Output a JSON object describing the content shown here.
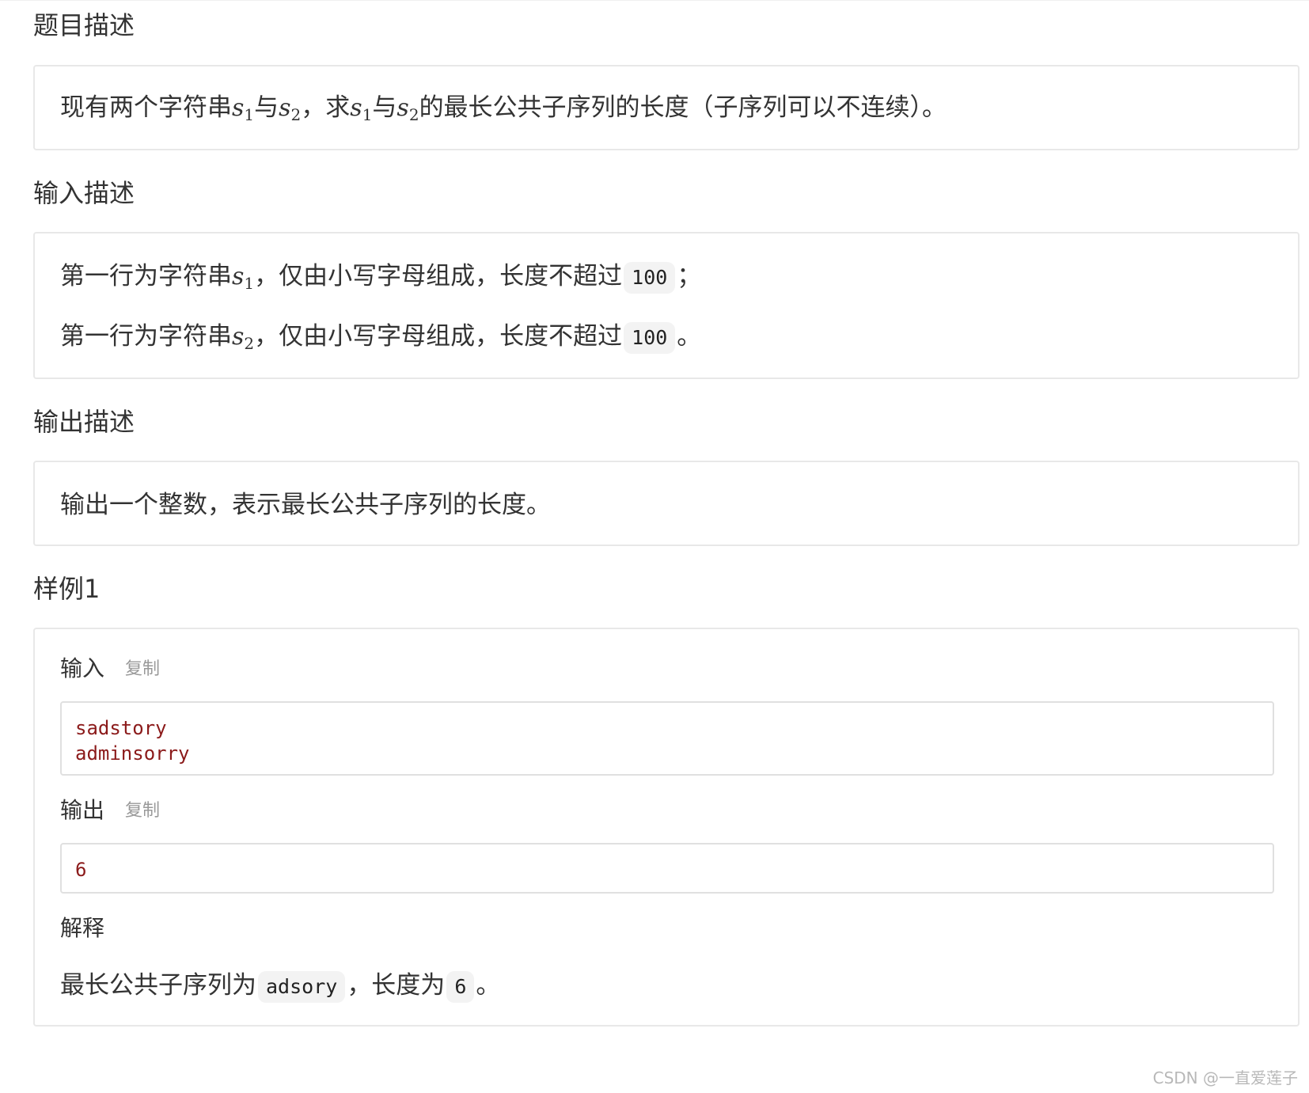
{
  "sections": {
    "description": {
      "title": "题目描述",
      "text_a": "现有两个字符串",
      "var_s": "s",
      "sub_1": "1",
      "sub_2": "2",
      "text_b": "与",
      "text_c": "，求",
      "text_d": "与",
      "text_e": "的最长公共子序列的长度（子序列可以不连续）。"
    },
    "input": {
      "title": "输入描述",
      "line1_prefix": "第一行为字符串",
      "line1_suffix": "，仅由小写字母组成，长度不超过",
      "line1_code": "100",
      "line1_end": "；",
      "line2_prefix": "第一行为字符串",
      "line2_suffix": "，仅由小写字母组成，长度不超过",
      "line2_code": "100",
      "line2_end": "。"
    },
    "output": {
      "title": "输出描述",
      "text": "输出一个整数，表示最长公共子序列的长度。"
    },
    "sample": {
      "title": "样例1",
      "input_label": "输入",
      "input_copy": "复制",
      "input_lines": [
        "sadstory",
        "adminsorry"
      ],
      "output_label": "输出",
      "output_copy": "复制",
      "output_value": "6",
      "explain_label": "解释",
      "explain_prefix": "最长公共子序列为",
      "explain_code1": "adsory",
      "explain_mid": "，长度为",
      "explain_code2": "6",
      "explain_end": "。"
    }
  },
  "watermark": "CSDN @一直爱莲子"
}
